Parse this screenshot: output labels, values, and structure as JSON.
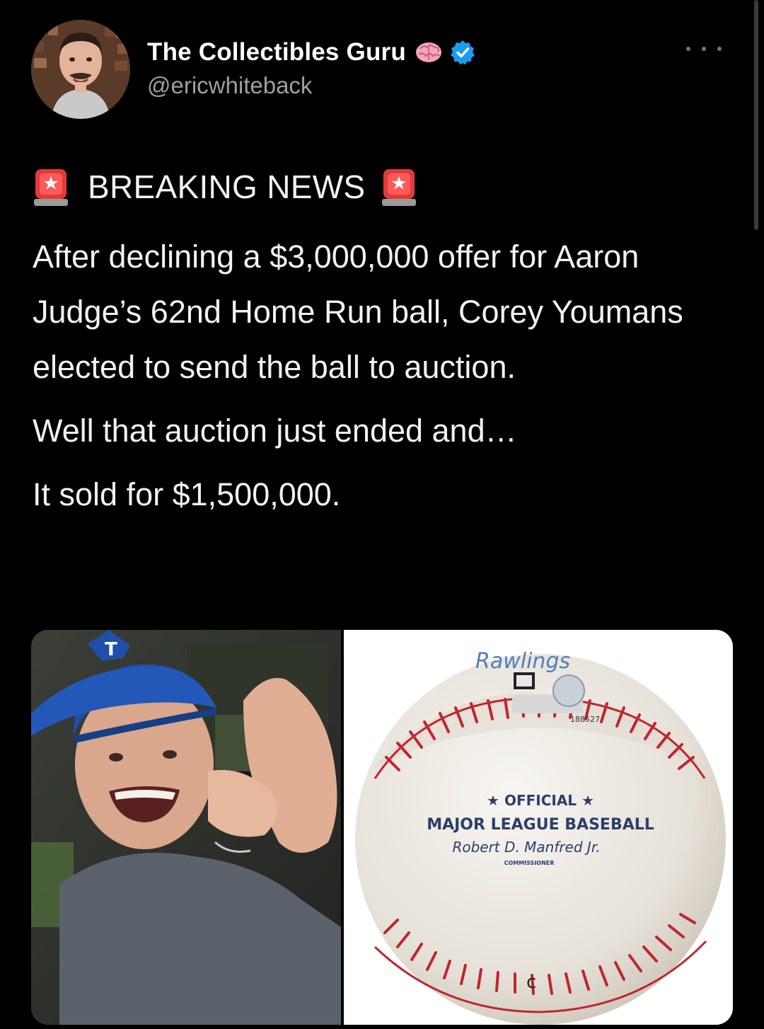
{
  "author": {
    "display_name": "The Collectibles Guru",
    "handle": "@ericwhiteback"
  },
  "icons": {
    "brain": "brain-emoji-icon",
    "verified": "verified-badge-icon",
    "more": "more-options-icon",
    "siren": "rotating-light-emoji-icon"
  },
  "colors": {
    "background": "#000000",
    "text": "#f2f2f2",
    "secondary_text": "#9aa0a6",
    "verified": "#1d9bf0"
  },
  "tweet": {
    "headline": "BREAKING NEWS",
    "paragraphs": [
      "After declining a $3,000,000 offer for Aaron Judge’s 62nd Home Run ball, Corey Youmans elected to send the ball to auction.",
      "Well that auction just ended and…",
      "It sold for $1,500,000."
    ]
  },
  "media": {
    "left_photo": "man-in-blue-cap-photo",
    "right_photo": "baseball-photo",
    "ball_text": {
      "brand": "Rawlings",
      "official": "★ OFFICIAL ★",
      "league": "MAJOR LEAGUE BASEBALL",
      "signature": "Robert D. Manfred Jr.",
      "commissioner": "COMMISSIONER",
      "serial": "188527"
    }
  }
}
